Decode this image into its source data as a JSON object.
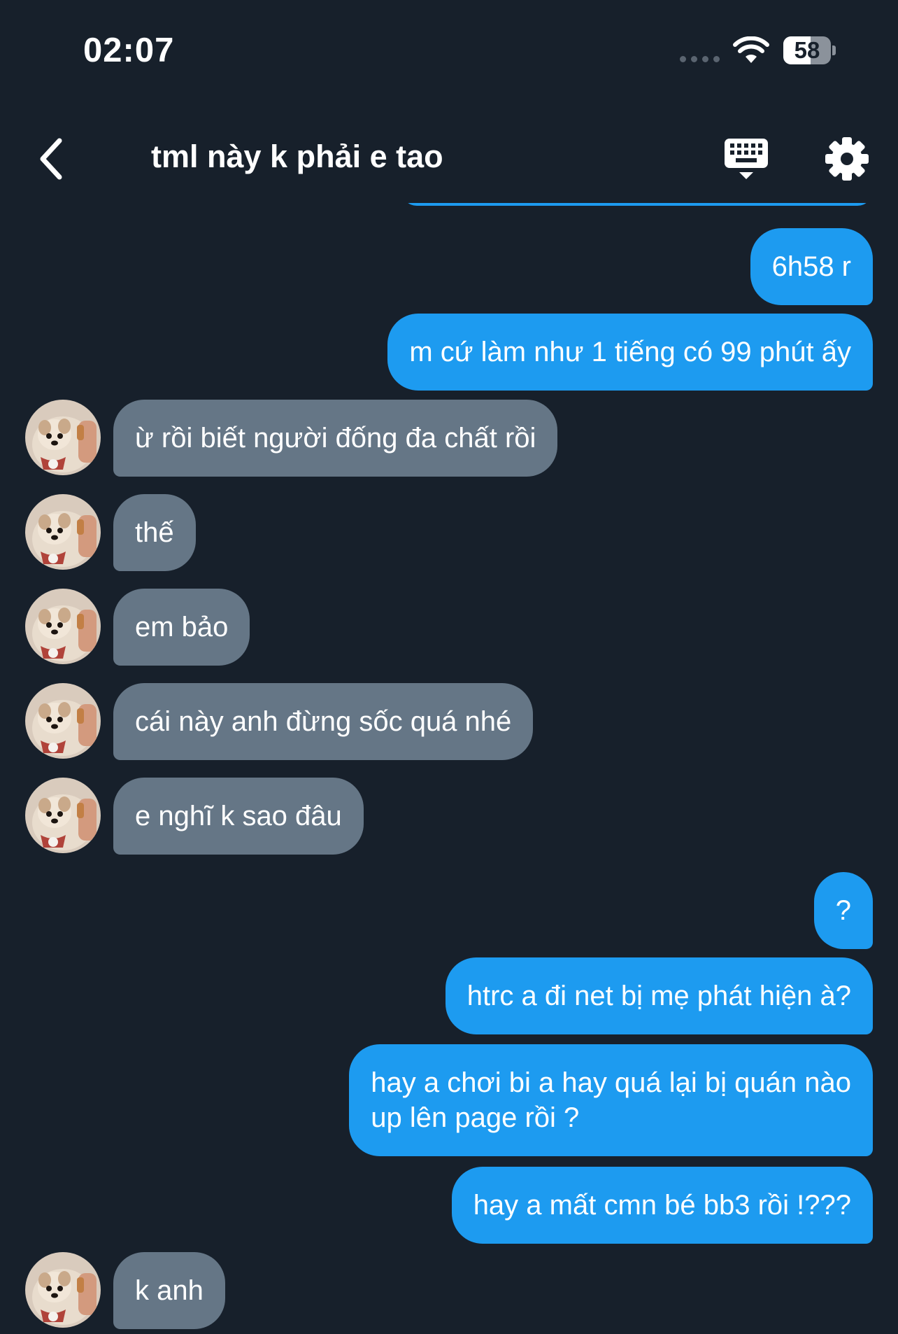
{
  "status_bar": {
    "time": "02:07",
    "battery_level": "58",
    "battery_fraction": 0.58,
    "icons": [
      "signal-dots-icon",
      "wifi-icon",
      "battery-icon"
    ]
  },
  "header": {
    "title": "tml này k phải e tao",
    "icons": [
      "back-chevron-icon",
      "keyboard-icon",
      "gear-icon"
    ]
  },
  "colors": {
    "background": "#17202b",
    "sent_bubble": "#1d9bf0",
    "received_bubble": "#657686",
    "text": "#ffffff"
  },
  "messages": [
    {
      "side": "sent",
      "text": "6h58 r"
    },
    {
      "side": "sent",
      "text": "m cứ làm như 1 tiếng có 99 phút ấy"
    },
    {
      "side": "received",
      "text": "ừ rồi biết người đống đa chất rồi"
    },
    {
      "side": "received",
      "text": "thế"
    },
    {
      "side": "received",
      "text": "em bảo"
    },
    {
      "side": "received",
      "text": "cái này anh đừng sốc quá nhé"
    },
    {
      "side": "received",
      "text": "e nghĩ k sao đâu"
    },
    {
      "side": "sent",
      "text": "?"
    },
    {
      "side": "sent",
      "text": "htrc a đi net bị mẹ phát hiện à?"
    },
    {
      "side": "sent",
      "text": "hay a chơi bi a hay quá lại bị quán nào\nup lên page rồi ?"
    },
    {
      "side": "sent",
      "text": "hay a mất cmn bé bb3 rồi !???"
    },
    {
      "side": "received",
      "text": "k anh"
    }
  ]
}
